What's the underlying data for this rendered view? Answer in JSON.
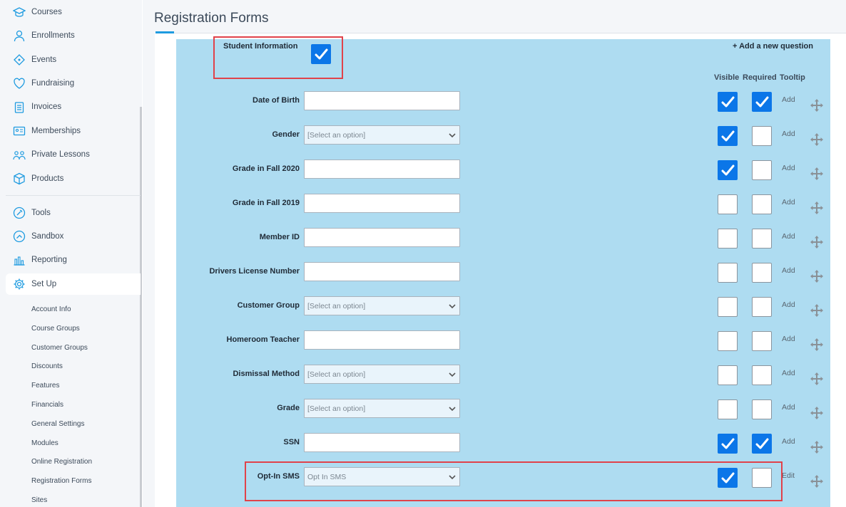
{
  "sidebar": {
    "items": [
      {
        "label": "Courses",
        "icon": "graduation-cap-icon"
      },
      {
        "label": "Enrollments",
        "icon": "person-icon"
      },
      {
        "label": "Events",
        "icon": "ticket-icon"
      },
      {
        "label": "Fundraising",
        "icon": "heart-dollar-icon"
      },
      {
        "label": "Invoices",
        "icon": "clipboard-icon"
      },
      {
        "label": "Memberships",
        "icon": "id-card-icon"
      },
      {
        "label": "Private Lessons",
        "icon": "people-icon"
      },
      {
        "label": "Products",
        "icon": "box-icon"
      },
      {
        "label": "Tools",
        "icon": "wrench-icon"
      },
      {
        "label": "Sandbox",
        "icon": "sandbox-icon"
      },
      {
        "label": "Reporting",
        "icon": "bar-chart-icon"
      },
      {
        "label": "Set Up",
        "icon": "gear-icon"
      }
    ],
    "subitems": [
      "Account Info",
      "Course Groups",
      "Customer Groups",
      "Discounts",
      "Features",
      "Financials",
      "General Settings",
      "Modules",
      "Online Registration",
      "Registration Forms",
      "Sites"
    ]
  },
  "page": {
    "title": "Registration Forms"
  },
  "form": {
    "section_title": "Student Information",
    "section_enabled": true,
    "add_question": "+ Add a new question",
    "columns": {
      "visible": "Visible",
      "required": "Required",
      "tooltip": "Tooltip"
    },
    "rows": [
      {
        "label": "Date of Birth",
        "type": "text",
        "value": "",
        "visible": true,
        "required": true,
        "tooltip": "Add"
      },
      {
        "label": "Gender",
        "type": "select",
        "value": "[Select an option]",
        "visible": true,
        "required": false,
        "tooltip": "Add"
      },
      {
        "label": "Grade in Fall 2020",
        "type": "text",
        "value": "",
        "visible": true,
        "required": false,
        "tooltip": "Add"
      },
      {
        "label": "Grade in Fall 2019",
        "type": "text",
        "value": "",
        "visible": false,
        "required": false,
        "tooltip": "Add"
      },
      {
        "label": "Member ID",
        "type": "text",
        "value": "",
        "visible": false,
        "required": false,
        "tooltip": "Add"
      },
      {
        "label": "Drivers License Number",
        "type": "text",
        "value": "",
        "visible": false,
        "required": false,
        "tooltip": "Add"
      },
      {
        "label": "Customer Group",
        "type": "select",
        "value": "[Select an option]",
        "visible": false,
        "required": false,
        "tooltip": "Add"
      },
      {
        "label": "Homeroom Teacher",
        "type": "text",
        "value": "",
        "visible": false,
        "required": false,
        "tooltip": "Add"
      },
      {
        "label": "Dismissal Method",
        "type": "select",
        "value": "[Select an option]",
        "visible": false,
        "required": false,
        "tooltip": "Add"
      },
      {
        "label": "Grade",
        "type": "select",
        "value": "[Select an option]",
        "visible": false,
        "required": false,
        "tooltip": "Add"
      },
      {
        "label": "SSN",
        "type": "text",
        "value": "",
        "visible": true,
        "required": true,
        "tooltip": "Add"
      },
      {
        "label": "Opt-In SMS",
        "type": "select",
        "value": "Opt In SMS",
        "visible": true,
        "required": false,
        "tooltip": "Edit"
      }
    ]
  },
  "colors": {
    "accent": "#1e9be0",
    "panel": "#aedcf1",
    "checkbox_on": "#0b76e8",
    "highlight": "#e0424a"
  }
}
